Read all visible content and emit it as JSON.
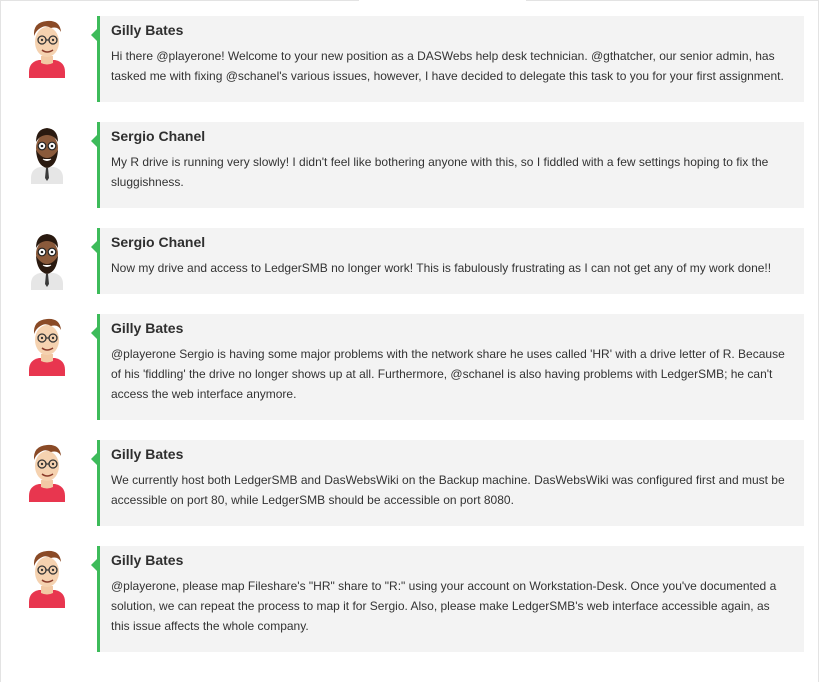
{
  "messages": [
    {
      "author": "Gilly Bates",
      "avatar": "gilly-avatar",
      "text": "Hi there @playerone! Welcome to your new position as a DASWebs help desk technician. @gthatcher, our senior admin, has tasked me with fixing @schanel's various issues, however, I have decided to delegate this task to you for your first assignment."
    },
    {
      "author": "Sergio Chanel",
      "avatar": "sergio-avatar",
      "text": "My R drive is running very slowly! I didn't feel like bothering anyone with this, so I fiddled with a few settings hoping to fix the sluggishness."
    },
    {
      "author": "Sergio Chanel",
      "avatar": "sergio-avatar",
      "text": "Now my drive and access to LedgerSMB no longer work! This is fabulously frustrating as I can not get any of my work done!!"
    },
    {
      "author": "Gilly Bates",
      "avatar": "gilly-avatar",
      "text": "@playerone Sergio is having some major problems with the network share he uses called 'HR' with a drive letter of R. Because of his 'fiddling' the drive no longer shows up at all. Furthermore, @schanel is also having problems with LedgerSMB; he can't access the web interface anymore."
    },
    {
      "author": "Gilly Bates",
      "avatar": "gilly-avatar",
      "text": "We currently host both LedgerSMB and DasWebsWiki on the Backup machine. DasWebsWiki was configured first and must be accessible on port 80, while LedgerSMB should be accessible on port 8080."
    },
    {
      "author": "Gilly Bates",
      "avatar": "gilly-avatar",
      "text": "@playerone, please map Fileshare's \"HR\" share to \"R:\" using your account on Workstation-Desk. Once you've documented a solution, we can repeat the process to map it for Sergio. Also, please make LedgerSMB's web interface accessible again, as this issue affects the whole company."
    }
  ],
  "colors": {
    "accent": "#3dbb5a",
    "bubble_bg": "#f3f3f3",
    "shirt_red": "#e8364f"
  }
}
